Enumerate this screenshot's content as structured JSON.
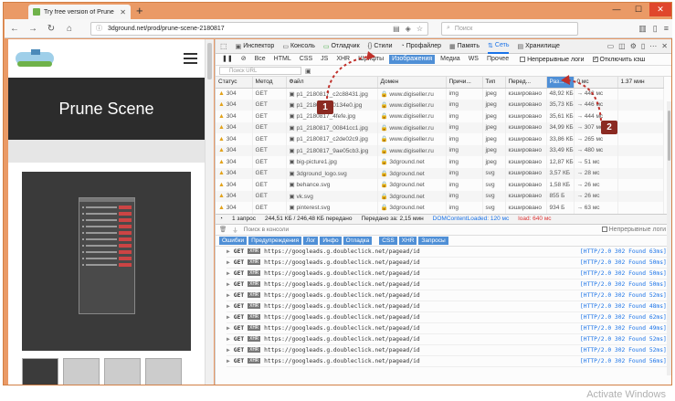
{
  "browser": {
    "tab_title": "Try free version of Prune Scene",
    "new_tab": "+",
    "url": "3dground.net/prod/prune-scene-2180817",
    "search_placeholder": "Поиск"
  },
  "site": {
    "hero_title": "Prune Scene"
  },
  "devtools": {
    "tabs": [
      "Инспектор",
      "Консоль",
      "Отладчик",
      "Стили",
      "Профайлер",
      "Память",
      "Сеть",
      "Хранилище"
    ],
    "active_tab": "Сеть",
    "filters": [
      "Все",
      "HTML",
      "CSS",
      "JS",
      "XHR",
      "Шрифты",
      "Изображения",
      "Медиа",
      "WS",
      "Прочее"
    ],
    "active_filter": "Изображения",
    "persist_logs_label": "Непрерывные логи",
    "disable_cache_label": "Отключить кэш",
    "url_filter_placeholder": "Поиск URL",
    "columns": [
      "Статус",
      "Метод",
      "Файл",
      "Домен",
      "Причи...",
      "Тип",
      "Перед...",
      "Раз...",
      "0 мс",
      "1.37 мин"
    ],
    "rows": [
      {
        "status": "304",
        "method": "GET",
        "file": "p1_2180817_c2c88431.jpg",
        "domain": "www.digiseller.ru",
        "cause": "img",
        "type": "jpeg",
        "transferred": "кэшировано",
        "size": "48,92 КБ",
        "time": "→ 442 мс"
      },
      {
        "status": "304",
        "method": "GET",
        "file": "p1_2180817_0134e0.jpg",
        "domain": "www.digiseller.ru",
        "cause": "img",
        "type": "jpeg",
        "transferred": "кэшировано",
        "size": "35,73 КБ",
        "time": "→ 446 мс"
      },
      {
        "status": "304",
        "method": "GET",
        "file": "p1_2180817_4fefe.jpg",
        "domain": "www.digiseller.ru",
        "cause": "img",
        "type": "jpeg",
        "transferred": "кэшировано",
        "size": "35,61 КБ",
        "time": "→ 444 мс"
      },
      {
        "status": "304",
        "method": "GET",
        "file": "p1_2180817_00841cc1.jpg",
        "domain": "www.digiseller.ru",
        "cause": "img",
        "type": "jpeg",
        "transferred": "кэшировано",
        "size": "34,99 КБ",
        "time": "→ 307 мс"
      },
      {
        "status": "304",
        "method": "GET",
        "file": "p1_2180817_c2de02c9.jpg",
        "domain": "www.digiseller.ru",
        "cause": "img",
        "type": "jpeg",
        "transferred": "кэшировано",
        "size": "33,86 КБ",
        "time": "→ 265 мс"
      },
      {
        "status": "304",
        "method": "GET",
        "file": "p1_2180817_9ae05cb3.jpg",
        "domain": "www.digiseller.ru",
        "cause": "img",
        "type": "jpeg",
        "transferred": "кэшировано",
        "size": "33,49 КБ",
        "time": "→ 480 мс"
      },
      {
        "status": "304",
        "method": "GET",
        "file": "big-picture1.jpg",
        "domain": "3dground.net",
        "cause": "img",
        "type": "jpeg",
        "transferred": "кэшировано",
        "size": "12,87 КБ",
        "time": "→ 51 мс"
      },
      {
        "status": "304",
        "method": "GET",
        "file": "3dground_logo.svg",
        "domain": "3dground.net",
        "cause": "img",
        "type": "svg",
        "transferred": "кэшировано",
        "size": "3,57 КБ",
        "time": "→ 28 мс"
      },
      {
        "status": "304",
        "method": "GET",
        "file": "behance.svg",
        "domain": "3dground.net",
        "cause": "img",
        "type": "svg",
        "transferred": "кэшировано",
        "size": "1,58 КБ",
        "time": "→ 26 мс"
      },
      {
        "status": "304",
        "method": "GET",
        "file": "vk.svg",
        "domain": "3dground.net",
        "cause": "img",
        "type": "svg",
        "transferred": "кэшировано",
        "size": "855 Б",
        "time": "→ 26 мс"
      },
      {
        "status": "304",
        "method": "GET",
        "file": "pinterest.svg",
        "domain": "3dground.net",
        "cause": "img",
        "type": "svg",
        "transferred": "кэшировано",
        "size": "934 Б",
        "time": "→ 63 мс"
      }
    ],
    "footer": {
      "requests": "1 запрос",
      "transferred": "244,51 КБ / 246,48 КБ передано",
      "time": "Передано за: 2,15 мин",
      "dcl": "DOMContentLoaded: 120 мс",
      "load": "load: 640 мс"
    },
    "console_filter_placeholder": "Поиск в консоли",
    "console_persist_label": "Непрерывные логи",
    "console_filters": [
      "Ошибки",
      "Предупреждения",
      "Лог",
      "Инфо",
      "Отладка",
      "CSS",
      "XHR",
      "Запросы"
    ],
    "console_rows": [
      {
        "method": "GET",
        "tag": "XHR",
        "url": "https://googleads.g.doubleclick.net/pagead/id",
        "status": "[HTTP/2.0 302 Found 63ms]"
      },
      {
        "method": "GET",
        "tag": "XHR",
        "url": "https://googleads.g.doubleclick.net/pagead/id",
        "status": "[HTTP/2.0 302 Found 50ms]"
      },
      {
        "method": "GET",
        "tag": "XHR",
        "url": "https://googleads.g.doubleclick.net/pagead/id",
        "status": "[HTTP/2.0 302 Found 50ms]"
      },
      {
        "method": "GET",
        "tag": "XHR",
        "url": "https://googleads.g.doubleclick.net/pagead/id",
        "status": "[HTTP/2.0 302 Found 50ms]"
      },
      {
        "method": "GET",
        "tag": "XHR",
        "url": "https://googleads.g.doubleclick.net/pagead/id",
        "status": "[HTTP/2.0 302 Found 52ms]"
      },
      {
        "method": "GET",
        "tag": "XHR",
        "url": "https://googleads.g.doubleclick.net/pagead/id",
        "status": "[HTTP/2.0 302 Found 48ms]"
      },
      {
        "method": "GET",
        "tag": "XHR",
        "url": "https://googleads.g.doubleclick.net/pagead/id",
        "status": "[HTTP/2.0 302 Found 62ms]"
      },
      {
        "method": "GET",
        "tag": "XHR",
        "url": "https://googleads.g.doubleclick.net/pagead/id",
        "status": "[HTTP/2.0 302 Found 49ms]"
      },
      {
        "method": "GET",
        "tag": "XHR",
        "url": "https://googleads.g.doubleclick.net/pagead/id",
        "status": "[HTTP/2.0 302 Found 52ms]"
      },
      {
        "method": "GET",
        "tag": "XHR",
        "url": "https://googleads.g.doubleclick.net/pagead/id",
        "status": "[HTTP/2.0 302 Found 52ms]"
      },
      {
        "method": "GET",
        "tag": "XHR",
        "url": "https://googleads.g.doubleclick.net/pagead/id",
        "status": "[HTTP/2.0 302 Found 56ms]"
      }
    ]
  },
  "annotations": {
    "badge1": "1",
    "badge2": "2"
  },
  "watermark": "Activate Windows",
  "colors": {
    "frame": "#ea9a66",
    "accent": "#4f8fd6",
    "badge": "#8b2a22"
  }
}
